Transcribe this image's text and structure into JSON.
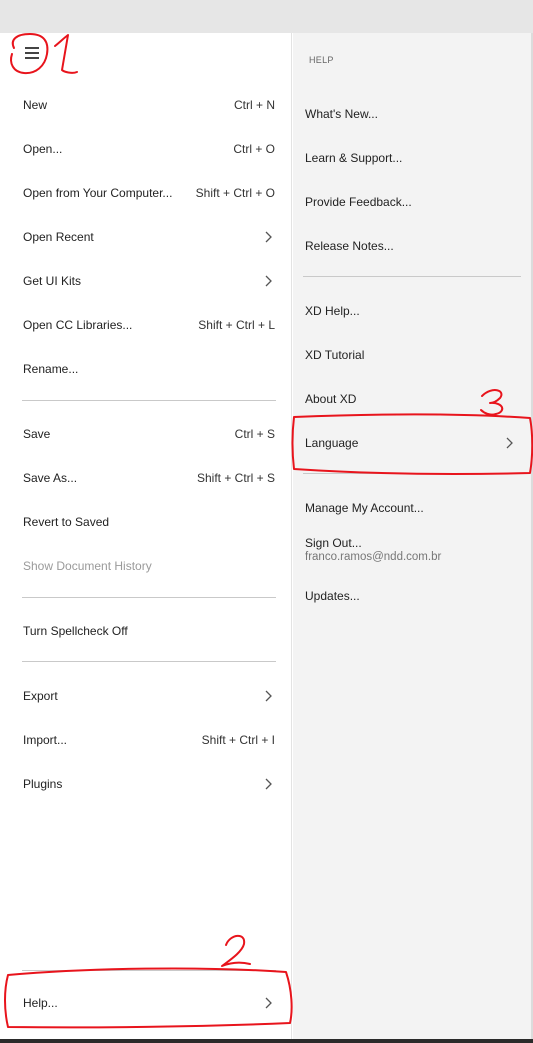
{
  "file_menu": {
    "items": [
      {
        "label": "New",
        "shortcut": "Ctrl + N"
      },
      {
        "label": "Open...",
        "shortcut": "Ctrl + O"
      },
      {
        "label": "Open from Your Computer...",
        "shortcut": "Shift + Ctrl + O"
      },
      {
        "label": "Open Recent",
        "submenu": true
      },
      {
        "label": "Get UI Kits",
        "submenu": true
      },
      {
        "label": "Open CC Libraries...",
        "shortcut": "Shift + Ctrl + L"
      },
      {
        "label": "Rename..."
      },
      {
        "label": "Save",
        "shortcut": "Ctrl + S"
      },
      {
        "label": "Save As...",
        "shortcut": "Shift + Ctrl + S"
      },
      {
        "label": "Revert to Saved"
      },
      {
        "label": "Show Document History",
        "disabled": true
      },
      {
        "label": "Turn Spellcheck Off"
      },
      {
        "label": "Export",
        "submenu": true
      },
      {
        "label": "Import...",
        "shortcut": "Shift + Ctrl + I"
      },
      {
        "label": "Plugins",
        "submenu": true
      },
      {
        "label": "Help...",
        "submenu": true
      }
    ]
  },
  "help_menu": {
    "title": "HELP",
    "items": [
      {
        "label": "What's New..."
      },
      {
        "label": "Learn & Support..."
      },
      {
        "label": "Provide Feedback..."
      },
      {
        "label": "Release Notes..."
      },
      {
        "label": "XD Help..."
      },
      {
        "label": "XD Tutorial"
      },
      {
        "label": "About XD"
      },
      {
        "label": "Language",
        "submenu": true
      },
      {
        "label": "Manage My Account..."
      },
      {
        "label": "Sign Out...",
        "sublabel": "franco.ramos@ndd.com.br"
      },
      {
        "label": "Updates..."
      }
    ]
  },
  "annotations": {
    "color": "#e8141c",
    "marks": [
      "1",
      "2",
      "3"
    ]
  },
  "colors": {
    "left_bg": "#ffffff",
    "right_bg": "#f3f3f3",
    "top_bar": "#e6e6e6",
    "disabled_text": "#9a9a9a"
  }
}
